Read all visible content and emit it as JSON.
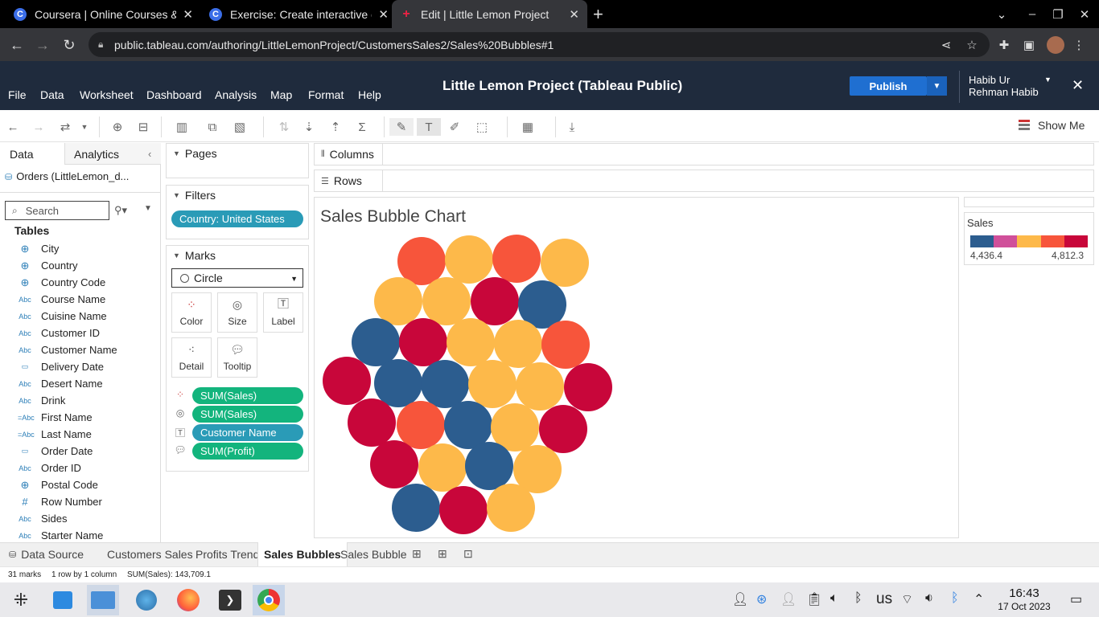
{
  "browser": {
    "tabs": [
      {
        "title": "Coursera | Online Courses &",
        "favicon": "C"
      },
      {
        "title": "Exercise: Create interactive d",
        "favicon": "C"
      },
      {
        "title": "Edit | Little Lemon Project",
        "favicon": "+"
      }
    ],
    "url": "public.tableau.com/authoring/LittleLemonProject/CustomersSales2/Sales%20Bubbles#1"
  },
  "tableau": {
    "menu": [
      "File",
      "Data",
      "Worksheet",
      "Dashboard",
      "Analysis",
      "Map",
      "Format",
      "Help"
    ],
    "title": "Little Lemon Project (Tableau Public)",
    "publish_label": "Publish",
    "user": "Habib Ur Rehman Habib",
    "show_me": "Show Me"
  },
  "data_pane": {
    "tab_data": "Data",
    "tab_analytics": "Analytics",
    "datasource": "Orders (LittleLemon_d...",
    "search_placeholder": "Search",
    "tables_header": "Tables",
    "fields": [
      {
        "name": "City",
        "type": "geo"
      },
      {
        "name": "Country",
        "type": "geo"
      },
      {
        "name": "Country Code",
        "type": "geo"
      },
      {
        "name": "Course Name",
        "type": "abc"
      },
      {
        "name": "Cuisine Name",
        "type": "abc"
      },
      {
        "name": "Customer ID",
        "type": "abc"
      },
      {
        "name": "Customer Name",
        "type": "abc"
      },
      {
        "name": "Delivery Date",
        "type": "date"
      },
      {
        "name": "Desert Name",
        "type": "abc"
      },
      {
        "name": "Drink",
        "type": "abc"
      },
      {
        "name": "First Name",
        "type": "abc-calc"
      },
      {
        "name": "Last Name",
        "type": "abc-calc"
      },
      {
        "name": "Order Date",
        "type": "date"
      },
      {
        "name": "Order ID",
        "type": "abc"
      },
      {
        "name": "Postal Code",
        "type": "geo"
      },
      {
        "name": "Row Number",
        "type": "num"
      },
      {
        "name": "Sides",
        "type": "abc"
      },
      {
        "name": "Starter Name",
        "type": "abc"
      }
    ]
  },
  "shelves": {
    "pages": "Pages",
    "filters": "Filters",
    "filter_pill": "Country: United States",
    "marks": "Marks",
    "mark_type": "Circle",
    "mark_buttons": [
      "Color",
      "Size",
      "Label",
      "Detail",
      "Tooltip"
    ],
    "mark_pills": [
      {
        "label": "SUM(Sales)",
        "kind": "color",
        "color": "green"
      },
      {
        "label": "SUM(Sales)",
        "kind": "size",
        "color": "green"
      },
      {
        "label": "Customer Name",
        "kind": "label",
        "color": "blue"
      },
      {
        "label": "SUM(Profit)",
        "kind": "tooltip",
        "color": "green"
      }
    ],
    "columns": "Columns",
    "rows": "Rows"
  },
  "view": {
    "title": "Sales Bubble Chart"
  },
  "legend": {
    "title": "Sales",
    "min": "4,436.4",
    "max": "4,812.3",
    "colors": [
      "#2c5d8f",
      "#d0509a",
      "#fdb94a",
      "#f7553b",
      "#c8063a"
    ]
  },
  "sheets": {
    "data_source": "Data Source",
    "tabs": [
      "Customers Sales",
      "Profits Trend",
      "Sales Bubbles",
      "Sales Bubble"
    ],
    "active": "Sales Bubbles"
  },
  "status": {
    "marks": "31 marks",
    "dims": "1 row by 1 column",
    "sum": "SUM(Sales): 143,709.1"
  },
  "system": {
    "kbd": "us",
    "time": "16:43",
    "date": "17 Oct 2023"
  }
}
